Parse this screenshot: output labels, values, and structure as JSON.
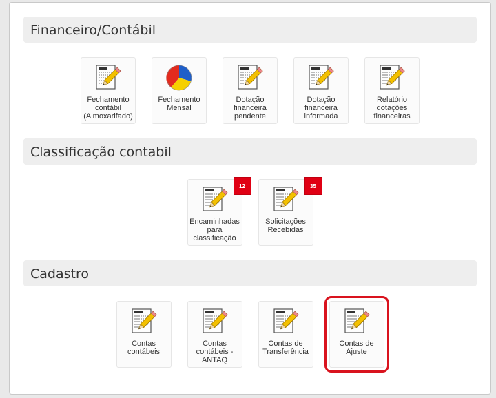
{
  "sections": [
    {
      "title": "Financeiro/Contábil",
      "tiles": [
        {
          "label": "Fechamento contábil (Almoxarifado)",
          "icon": "document-edit-icon"
        },
        {
          "label": "Fechamento Mensal",
          "icon": "pie-chart-icon"
        },
        {
          "label": "Dotação financeira pendente",
          "icon": "document-edit-icon"
        },
        {
          "label": "Dotação financeira informada",
          "icon": "document-edit-icon"
        },
        {
          "label": "Relatório dotações financeiras",
          "icon": "document-edit-icon"
        }
      ]
    },
    {
      "title": "Classificação contabil",
      "tiles": [
        {
          "label": "Encaminhadas para classificação",
          "icon": "document-edit-icon",
          "badge": "12"
        },
        {
          "label": "Solicitações Recebidas",
          "icon": "document-edit-icon",
          "badge": "35"
        }
      ]
    },
    {
      "title": "Cadastro",
      "tiles": [
        {
          "label": "Contas contábeis",
          "icon": "document-edit-icon"
        },
        {
          "label": "Contas contábeis - ANTAQ",
          "icon": "document-edit-icon"
        },
        {
          "label": "Contas de Transferência",
          "icon": "document-edit-icon"
        },
        {
          "label": "Contas de Ajuste",
          "icon": "document-edit-icon",
          "selected": true
        }
      ]
    }
  ],
  "colors": {
    "badge": "#e00014",
    "selection": "#d9131e"
  }
}
